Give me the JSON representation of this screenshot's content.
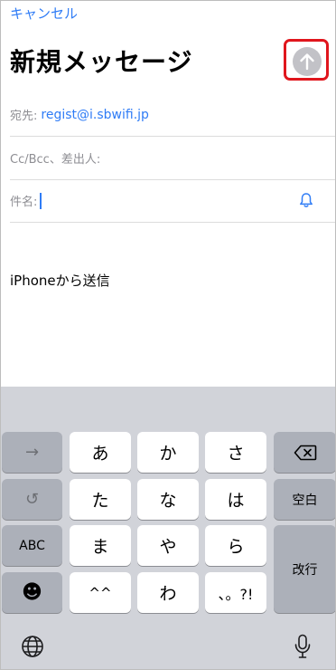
{
  "nav": {
    "cancel_label": "キャンセル"
  },
  "compose": {
    "title": "新規メッセージ",
    "to_label": "宛先:",
    "to_value": "regist@i.sbwifi.jp",
    "ccbcc_label": "Cc/Bcc、差出人:",
    "subject_label": "件名:",
    "signature": "iPhoneから送信"
  },
  "keyboard": {
    "row1": [
      "あ",
      "か",
      "さ"
    ],
    "row2": [
      "た",
      "な",
      "は"
    ],
    "row3": [
      "ま",
      "や",
      "ら"
    ],
    "row4": [
      "^^",
      "わ",
      "、。?!"
    ],
    "next_candidate_label": "→",
    "undo_label": "↺",
    "abc_label": "ABC",
    "emoji_label": "☻",
    "space_label": "空白",
    "return_label": "改行"
  },
  "colors": {
    "accent": "#2f7cf6",
    "highlight_border": "#e0161d",
    "send_disabled": "#c2c2c7",
    "keyboard_bg": "#d1d3d9"
  }
}
